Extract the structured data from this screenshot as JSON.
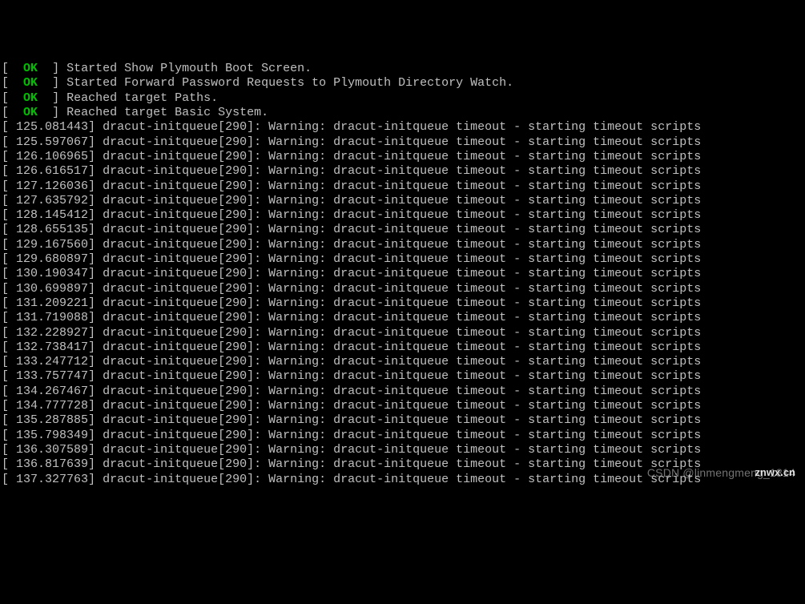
{
  "lbracket": "[",
  "rbracket": "]",
  "ok_label": "OK",
  "status_lines": [
    {
      "msg": "Started Show Plymouth Boot Screen."
    },
    {
      "msg": "Started Forward Password Requests to Plymouth Directory Watch."
    },
    {
      "msg": "Reached target Paths."
    },
    {
      "msg": "Reached target Basic System."
    }
  ],
  "process": "dracut-initqueue[290]",
  "warning_msg": "Warning: dracut-initqueue timeout - starting timeout scripts",
  "timestamps": [
    "125.081443",
    "125.597067",
    "126.106965",
    "126.616517",
    "127.126036",
    "127.635792",
    "128.145412",
    "128.655135",
    "129.167560",
    "129.680897",
    "130.190347",
    "130.699897",
    "131.209221",
    "131.719088",
    "132.228927",
    "132.738417",
    "133.247712",
    "133.757747",
    "134.267467",
    "134.777728",
    "135.287885",
    "135.798349",
    "136.307589",
    "136.817639",
    "137.327763"
  ],
  "watermark_left": "CSDN @linmengmeng_1314",
  "watermark_right": "znwx.cn"
}
